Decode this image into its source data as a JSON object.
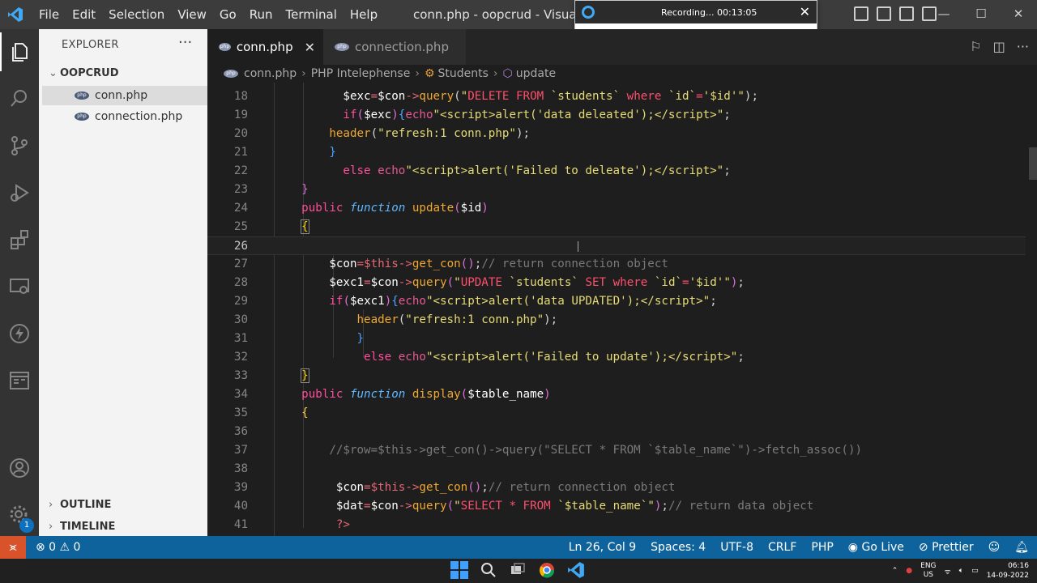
{
  "window": {
    "menu": [
      "File",
      "Edit",
      "Selection",
      "View",
      "Go",
      "Run",
      "Terminal",
      "Help"
    ],
    "title": "conn.php - oopcrud - Visual Stu",
    "controls": [
      "—",
      "☐",
      "✕"
    ]
  },
  "recorder": {
    "label": "Recording... 00:13:05",
    "close": "✕"
  },
  "sidebar": {
    "title": "EXPLORER",
    "more": "···",
    "folder": "OOPCRUD",
    "files": [
      "conn.php",
      "connection.php"
    ],
    "php_icon": "php",
    "outline": "OUTLINE",
    "timeline": "TIMELINE",
    "badge_count": "1"
  },
  "tabs": [
    {
      "label": "conn.php",
      "active": true
    },
    {
      "label": "connection.php",
      "active": false
    }
  ],
  "breadcrumb": [
    "conn.php",
    "PHP Intelephense",
    "Students",
    "update"
  ],
  "editor": {
    "current_line": 26,
    "lines": [
      {
        "n": "18"
      },
      {
        "n": "19"
      },
      {
        "n": "20"
      },
      {
        "n": "21"
      },
      {
        "n": "22"
      },
      {
        "n": "23"
      },
      {
        "n": "24"
      },
      {
        "n": "25"
      },
      {
        "n": "26"
      },
      {
        "n": "27"
      },
      {
        "n": "28"
      },
      {
        "n": "29"
      },
      {
        "n": "30"
      },
      {
        "n": "31"
      },
      {
        "n": "32"
      },
      {
        "n": "33"
      },
      {
        "n": "34"
      },
      {
        "n": "35"
      },
      {
        "n": "36"
      },
      {
        "n": "37"
      },
      {
        "n": "38"
      },
      {
        "n": "39"
      },
      {
        "n": "40"
      },
      {
        "n": "41"
      }
    ]
  },
  "status": {
    "errors": "⊗ 0 ⚠ 0",
    "position": "Ln 26, Col 9",
    "spaces": "Spaces: 4",
    "encoding": "UTF-8",
    "eol": "CRLF",
    "language": "PHP",
    "golive": "Go Live",
    "prettier": "Prettier"
  },
  "taskbar": {
    "lang_top": "ENG",
    "lang_bottom": "US",
    "time": "06:16",
    "date": "14-09-2022"
  },
  "colors": {
    "accent": "#0e639c",
    "remote": "#d9532a",
    "activity_bg": "#333333",
    "editor_bg": "#1e1e1e"
  }
}
